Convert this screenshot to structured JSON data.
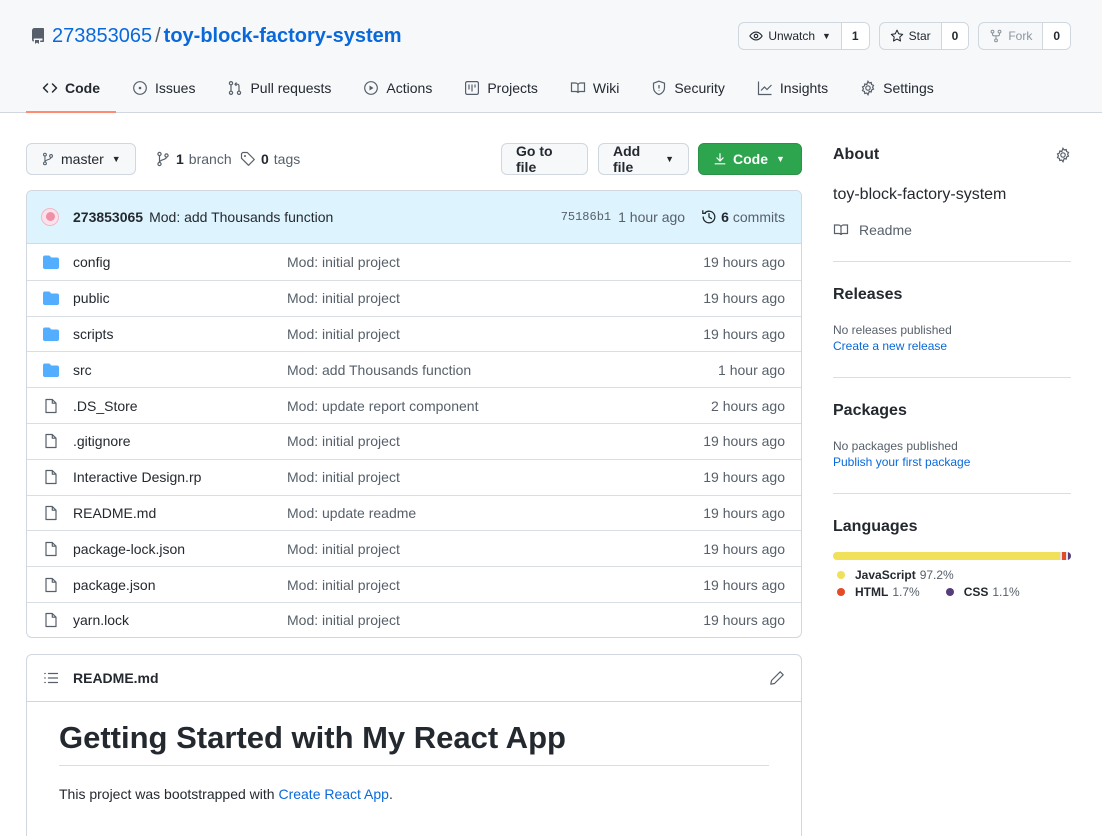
{
  "repo": {
    "owner": "273853065",
    "separator": "/",
    "name": "toy-block-factory-system"
  },
  "actions": {
    "watch": {
      "label": "Unwatch",
      "count": "1"
    },
    "star": {
      "label": "Star",
      "count": "0"
    },
    "fork": {
      "label": "Fork",
      "count": "0"
    }
  },
  "tabs": [
    {
      "label": "Code",
      "icon": "code-icon"
    },
    {
      "label": "Issues",
      "icon": "issue-icon"
    },
    {
      "label": "Pull requests",
      "icon": "pull-request-icon"
    },
    {
      "label": "Actions",
      "icon": "play-icon"
    },
    {
      "label": "Projects",
      "icon": "project-icon"
    },
    {
      "label": "Wiki",
      "icon": "book-icon"
    },
    {
      "label": "Security",
      "icon": "shield-icon"
    },
    {
      "label": "Insights",
      "icon": "graph-icon"
    },
    {
      "label": "Settings",
      "icon": "gear-icon"
    }
  ],
  "filenav": {
    "branch": "master",
    "branches_count": "1",
    "branches_label": "branch",
    "tags_count": "0",
    "tags_label": "tags",
    "go_to_file": "Go to file",
    "add_file": "Add file",
    "code": "Code"
  },
  "commit": {
    "author": "273853065",
    "message": "Mod: add Thousands function",
    "sha": "75186b1",
    "time": "1 hour ago",
    "commits_count": "6",
    "commits_label": "commits"
  },
  "files": [
    {
      "type": "dir",
      "name": "config",
      "message": "Mod: initial project",
      "age": "19 hours ago"
    },
    {
      "type": "dir",
      "name": "public",
      "message": "Mod: initial project",
      "age": "19 hours ago"
    },
    {
      "type": "dir",
      "name": "scripts",
      "message": "Mod: initial project",
      "age": "19 hours ago"
    },
    {
      "type": "dir",
      "name": "src",
      "message": "Mod: add Thousands function",
      "age": "1 hour ago"
    },
    {
      "type": "file",
      "name": ".DS_Store",
      "message": "Mod: update report component",
      "age": "2 hours ago"
    },
    {
      "type": "file",
      "name": ".gitignore",
      "message": "Mod: initial project",
      "age": "19 hours ago"
    },
    {
      "type": "file",
      "name": "Interactive Design.rp",
      "message": "Mod: initial project",
      "age": "19 hours ago"
    },
    {
      "type": "file",
      "name": "README.md",
      "message": "Mod: update readme",
      "age": "19 hours ago"
    },
    {
      "type": "file",
      "name": "package-lock.json",
      "message": "Mod: initial project",
      "age": "19 hours ago"
    },
    {
      "type": "file",
      "name": "package.json",
      "message": "Mod: initial project",
      "age": "19 hours ago"
    },
    {
      "type": "file",
      "name": "yarn.lock",
      "message": "Mod: initial project",
      "age": "19 hours ago"
    }
  ],
  "readme": {
    "filename": "README.md",
    "heading": "Getting Started with My React App",
    "text_before": "This project was bootstrapped with ",
    "link": "Create React App",
    "text_after": "."
  },
  "sidebar": {
    "about_title": "About",
    "description": "toy-block-factory-system",
    "readme_label": "Readme",
    "releases_title": "Releases",
    "releases_none": "No releases published",
    "releases_link": "Create a new release",
    "packages_title": "Packages",
    "packages_none": "No packages published",
    "packages_link": "Publish your first package",
    "languages_title": "Languages",
    "languages": [
      {
        "name": "JavaScript",
        "percent": "97.2%",
        "share": 97.2,
        "color": "#f1e05a"
      },
      {
        "name": "HTML",
        "percent": "1.7%",
        "share": 1.7,
        "color": "#e34c26"
      },
      {
        "name": "CSS",
        "percent": "1.1%",
        "share": 1.1,
        "color": "#563d7c"
      }
    ]
  },
  "colors": {
    "link": "#0969da",
    "primary_button": "#2da44e",
    "folder": "#54aeff",
    "tab_underline": "#fd8c73",
    "commit_bar": "#ddf4ff"
  }
}
